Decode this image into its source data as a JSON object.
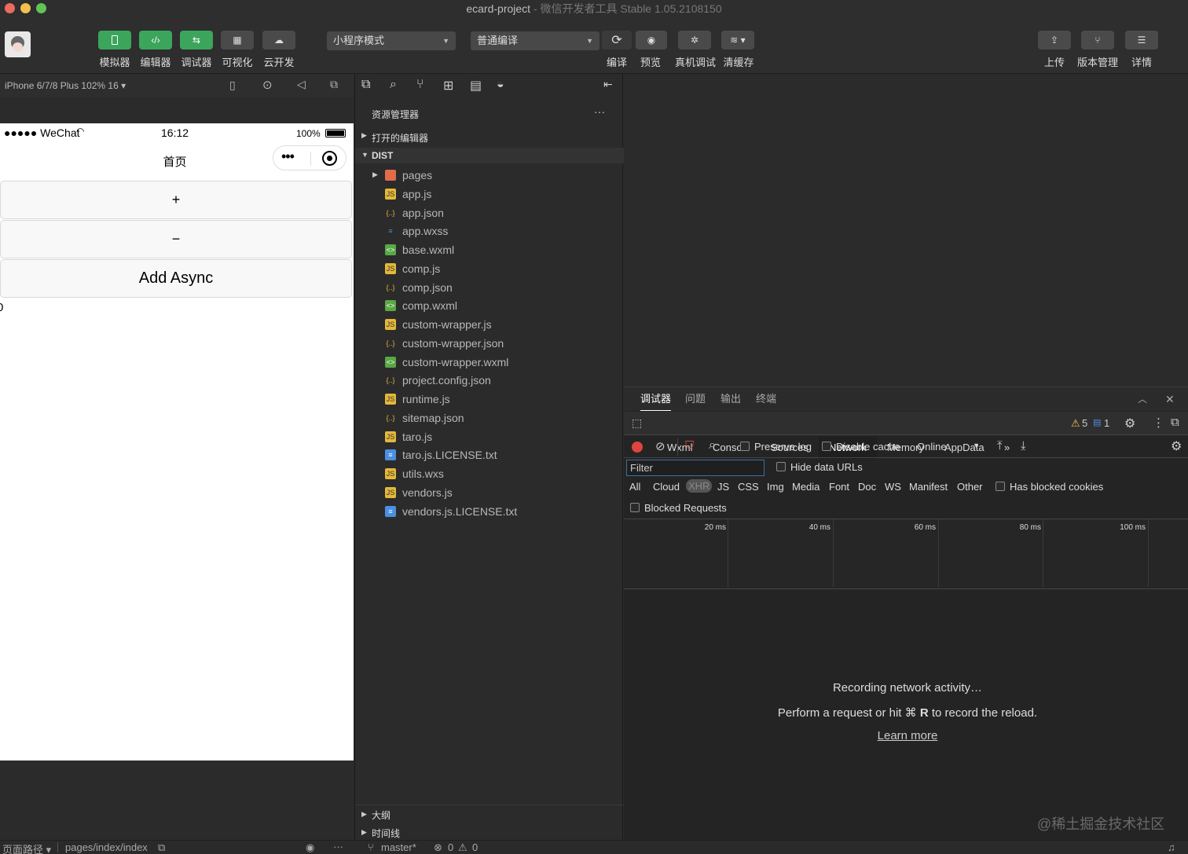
{
  "window": {
    "title": "ecard-project",
    "subtitle": "- 微信开发者工具 Stable 1.05.2108150"
  },
  "toolbar": {
    "simulator": "模拟器",
    "editor": "编辑器",
    "debugger": "调试器",
    "visual": "可视化",
    "cloud": "云开发",
    "mode_select": "小程序模式",
    "compile_select": "普通编译",
    "compile": "编译",
    "preview": "预览",
    "real_debug": "真机调试",
    "clear_cache": "清缓存",
    "upload": "上传",
    "version": "版本管理",
    "details": "详情"
  },
  "simulator": {
    "device": "iPhone 6/7/8 Plus 102% 16 ▾",
    "status": {
      "carrier": "●●●●● WeChat",
      "time": "16:12",
      "battery": "100%"
    },
    "nav_title": "首页",
    "buttons": [
      "+",
      "−",
      "Add Async"
    ],
    "counter": "0"
  },
  "explorer": {
    "title": "资源管理器",
    "open_editors": "打开的编辑器",
    "root": "DIST",
    "files": [
      {
        "name": "pages",
        "type": "folder"
      },
      {
        "name": "app.js",
        "type": "js"
      },
      {
        "name": "app.json",
        "type": "json"
      },
      {
        "name": "app.wxss",
        "type": "css"
      },
      {
        "name": "base.wxml",
        "type": "wxml"
      },
      {
        "name": "comp.js",
        "type": "js"
      },
      {
        "name": "comp.json",
        "type": "json"
      },
      {
        "name": "comp.wxml",
        "type": "wxml"
      },
      {
        "name": "custom-wrapper.js",
        "type": "js"
      },
      {
        "name": "custom-wrapper.json",
        "type": "json"
      },
      {
        "name": "custom-wrapper.wxml",
        "type": "wxml"
      },
      {
        "name": "project.config.json",
        "type": "json"
      },
      {
        "name": "runtime.js",
        "type": "js"
      },
      {
        "name": "sitemap.json",
        "type": "json"
      },
      {
        "name": "taro.js",
        "type": "js"
      },
      {
        "name": "taro.js.LICENSE.txt",
        "type": "txt"
      },
      {
        "name": "utils.wxs",
        "type": "js"
      },
      {
        "name": "vendors.js",
        "type": "js"
      },
      {
        "name": "vendors.js.LICENSE.txt",
        "type": "txt"
      }
    ],
    "outline": "大纲",
    "timeline": "时间线"
  },
  "devtools": {
    "top_tabs": [
      "调试器",
      "问题",
      "输出",
      "终端"
    ],
    "tabs": [
      "Wxml",
      "Console",
      "Sources",
      "Network",
      "Memory",
      "AppData"
    ],
    "active_tab": "Network",
    "warnings": "5",
    "messages": "1",
    "preserve_log": "Preserve log",
    "disable_cache": "Disable cache",
    "throttle": "Online",
    "filter_placeholder": "Filter",
    "hide_data_urls": "Hide data URLs",
    "types": [
      "All",
      "Cloud",
      "XHR",
      "JS",
      "CSS",
      "Img",
      "Media",
      "Font",
      "Doc",
      "WS",
      "Manifest",
      "Other"
    ],
    "has_blocked_cookies": "Has blocked cookies",
    "blocked_requests": "Blocked Requests",
    "ticks": [
      "20 ms",
      "40 ms",
      "60 ms",
      "80 ms",
      "100 ms"
    ],
    "recording": "Recording network activity…",
    "hint_pre": "Perform a request or hit ⌘",
    "hint_key": "R",
    "hint_post": "to record the reload.",
    "learn_more": "Learn more"
  },
  "statusbar": {
    "page_path_label": "页面路径 ▾",
    "page_path": "pages/index/index",
    "branch": "master*",
    "errors": "0",
    "warnings": "0"
  },
  "watermark": "@稀土掘金技术社区",
  "colors": {
    "accent_green": "#3ba55c",
    "record_red": "#e0443e",
    "filter_red": "#e0443e"
  }
}
